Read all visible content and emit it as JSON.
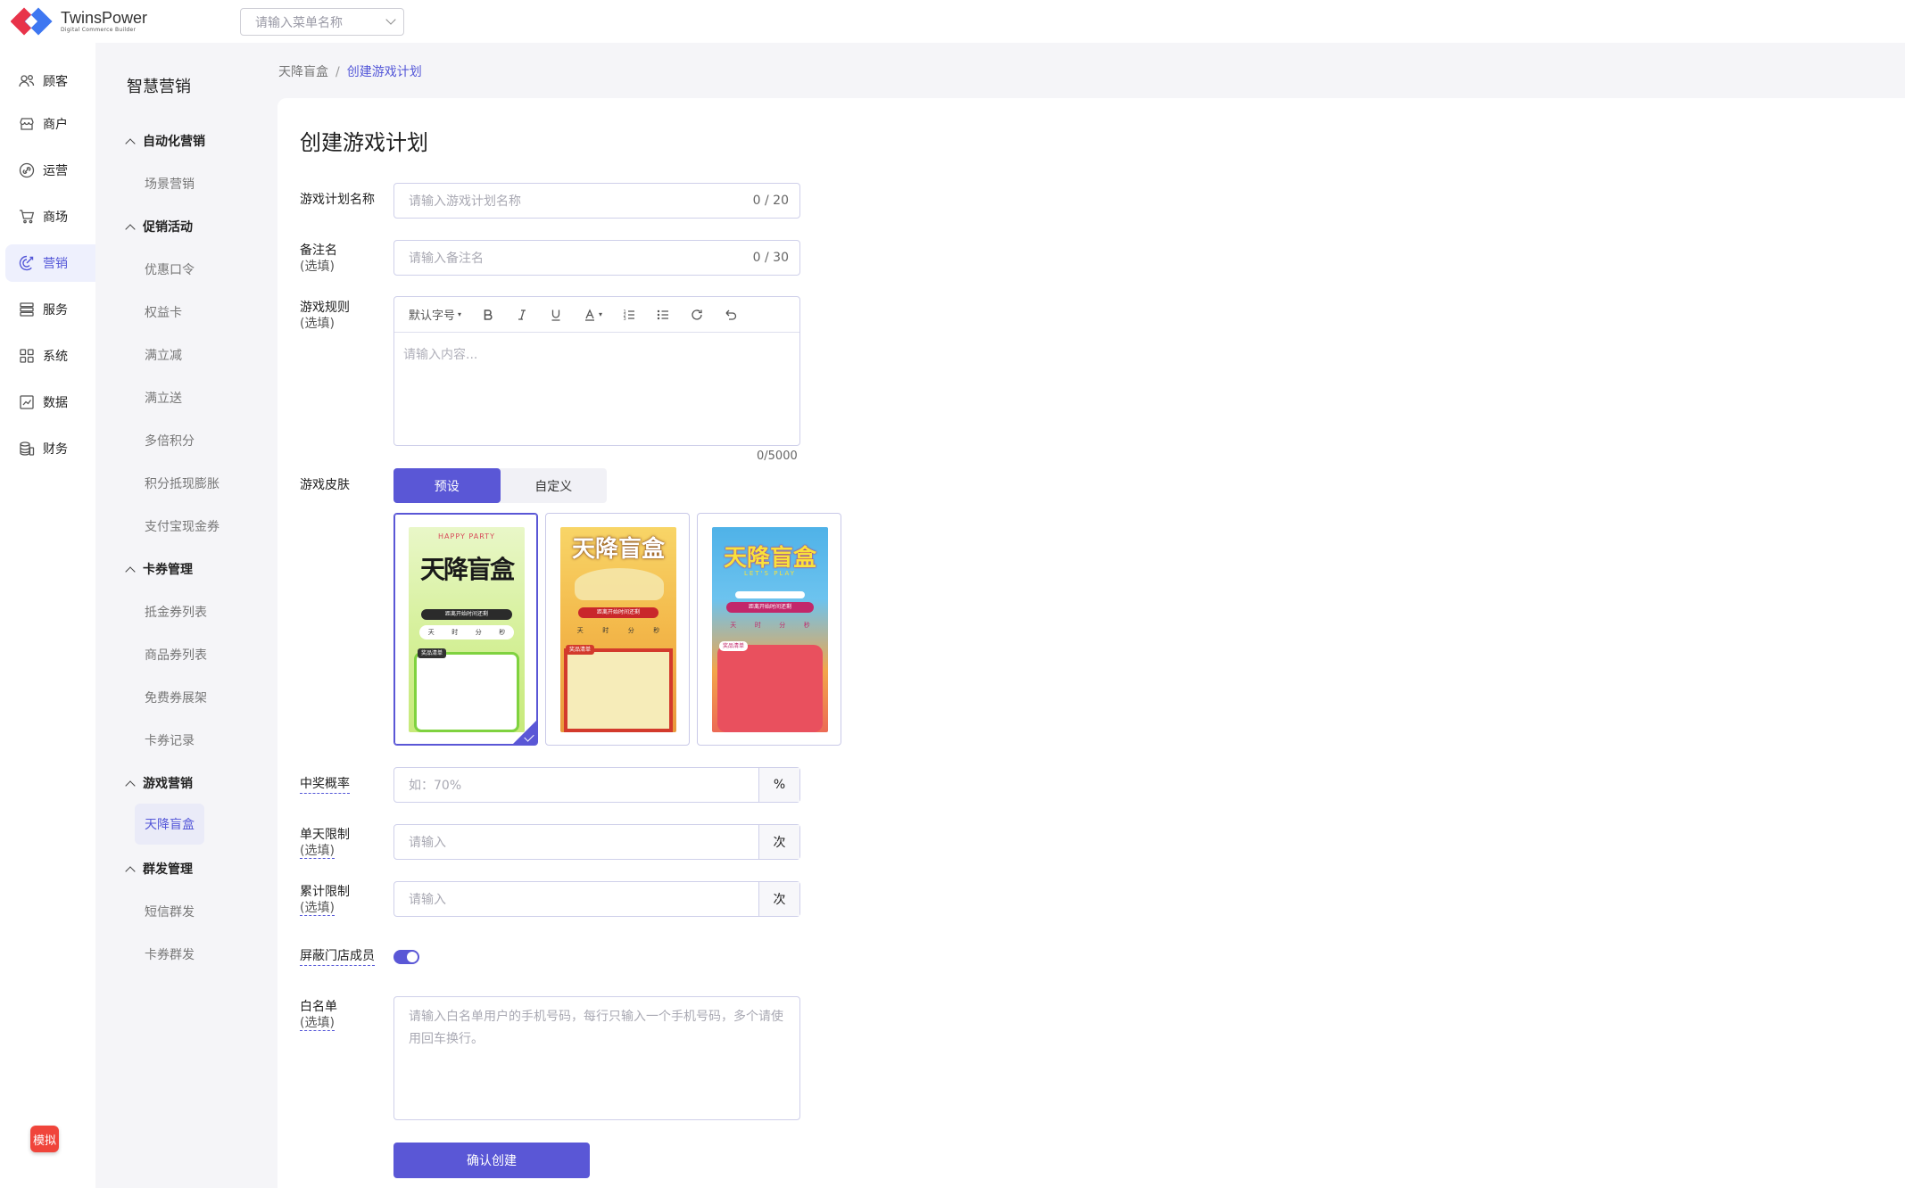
{
  "brand": {
    "name": "TwinsPower",
    "tagline": "Digital Commerce Builder"
  },
  "header": {
    "menu_search_placeholder": "请输入菜单名称"
  },
  "nav_primary": [
    {
      "label": "顾客",
      "icon": "users-icon"
    },
    {
      "label": "商户",
      "icon": "store-icon"
    },
    {
      "label": "运营",
      "icon": "link-icon"
    },
    {
      "label": "商场",
      "icon": "cart-icon"
    },
    {
      "label": "营销",
      "icon": "marketing-icon",
      "active": true
    },
    {
      "label": "服务",
      "icon": "list-icon"
    },
    {
      "label": "系统",
      "icon": "grid-icon"
    },
    {
      "label": "数据",
      "icon": "chart-icon"
    },
    {
      "label": "财务",
      "icon": "finance-icon"
    }
  ],
  "sim_badge": "模拟",
  "nav_secondary": {
    "title": "智慧营销",
    "groups": [
      {
        "label": "自动化营销",
        "items": [
          "场景营销"
        ]
      },
      {
        "label": "促销活动",
        "items": [
          "优惠口令",
          "权益卡",
          "满立减",
          "满立送",
          "多倍积分",
          "积分抵现膨胀",
          "支付宝现金券"
        ]
      },
      {
        "label": "卡券管理",
        "items": [
          "抵金券列表",
          "商品券列表",
          "免费券展架",
          "卡券记录"
        ]
      },
      {
        "label": "游戏营销",
        "items": [
          "天降盲盒"
        ]
      },
      {
        "label": "群发管理",
        "items": [
          "短信群发",
          "卡券群发"
        ]
      }
    ]
  },
  "breadcrumb": {
    "parent": "天降盲盒",
    "separator": "/",
    "current": "创建游戏计划"
  },
  "form": {
    "title": "创建游戏计划",
    "name": {
      "label": "游戏计划名称",
      "placeholder": "请输入游戏计划名称",
      "count": "0 / 20"
    },
    "remark": {
      "label": "备注名",
      "optional": "(选填)",
      "placeholder": "请输入备注名",
      "count": "0 / 30"
    },
    "rules": {
      "label": "游戏规则",
      "optional": "(选填)",
      "font_size": "默认字号",
      "placeholder": "请输入内容...",
      "count": "0/5000"
    },
    "skin": {
      "label": "游戏皮肤",
      "tabs": [
        "预设",
        "自定义"
      ],
      "active_tab": "预设",
      "options": [
        {
          "title": "天降盲盒",
          "tagline": "HAPPY PARTY",
          "countdown": "距离开始时间还剩",
          "units": [
            "天",
            "时",
            "分",
            "秒"
          ],
          "prize": "奖品清单",
          "selected": true,
          "theme": "#b6e86a"
        },
        {
          "title": "天降盲盒",
          "tagline": "",
          "countdown": "距离开始时间还剩",
          "units": [
            "天",
            "时",
            "分",
            "秒"
          ],
          "prize": "奖品清单",
          "selected": false,
          "theme": "#f4c24c"
        },
        {
          "title": "天降盲盒",
          "tagline": "LET'S PLAY",
          "countdown": "距离开始时间还剩",
          "units": [
            "天",
            "时",
            "分",
            "秒"
          ],
          "prize": "奖品清单",
          "selected": false,
          "theme": "#e95466"
        }
      ]
    },
    "win_rate": {
      "label": "中奖概率",
      "placeholder": "如：70%",
      "suffix": "%"
    },
    "daily_limit": {
      "label": "单天限制",
      "optional": "(选填)",
      "placeholder": "请输入",
      "suffix": "次"
    },
    "total_limit": {
      "label": "累计限制",
      "optional": "(选填)",
      "placeholder": "请输入",
      "suffix": "次"
    },
    "block_members": {
      "label": "屏蔽门店成员",
      "enabled": true
    },
    "whitelist": {
      "label": "白名单",
      "optional": "(选填)",
      "placeholder": "请输入白名单用户的手机号码，每行只输入一个手机号码，多个请使用回车换行。"
    },
    "submit": "确认创建"
  },
  "colors": {
    "primary": "#5a57d6",
    "badge": "#f0453b"
  }
}
